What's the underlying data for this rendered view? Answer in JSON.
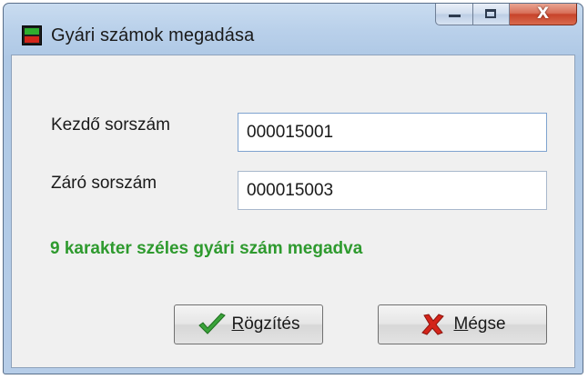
{
  "window": {
    "title": "Gyári számok megadása",
    "icon": "app-icon"
  },
  "caption_buttons": {
    "minimize_icon": "minimize-icon",
    "maximize_icon": "maximize-icon",
    "close_glyph": "X"
  },
  "form": {
    "start_label": "Kezdő sorszám",
    "start_value": "000015001",
    "end_label": "Záró sorszám",
    "end_value": "000015003",
    "info_text": "9 karakter széles gyári szám megadva",
    "info_color": "#2e9a2e"
  },
  "buttons": {
    "save_mnemonic": "R",
    "save_rest": "ögzítés",
    "save_icon": "checkmark-icon",
    "cancel_mnemonic": "M",
    "cancel_rest": "égse",
    "cancel_icon": "cross-icon"
  }
}
